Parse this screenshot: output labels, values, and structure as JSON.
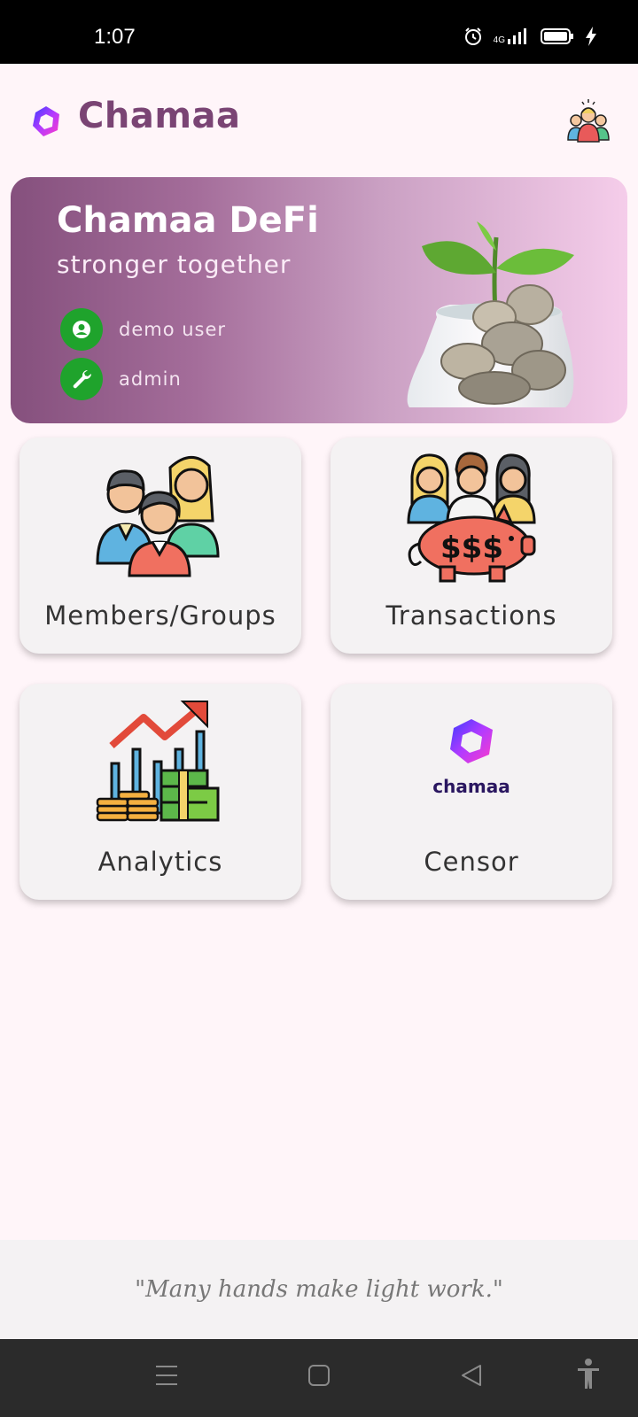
{
  "status_bar": {
    "time": "1:07",
    "network": "4G",
    "icons": [
      "alarm-icon",
      "signal-icon",
      "battery-icon",
      "charging-icon"
    ]
  },
  "app_bar": {
    "title": "Chamaa",
    "logo_icon": "chamaa-logo-icon",
    "avatar_icon": "group-avatar-icon"
  },
  "hero": {
    "title": "Chamaa DeFi",
    "subtitle": "stronger together",
    "user_label": "demo user",
    "role_label": "admin",
    "badge_color": "#1fa32c"
  },
  "cards": [
    {
      "label": "Members/Groups",
      "icon": "members-groups-icon"
    },
    {
      "label": "Transactions",
      "icon": "piggy-bank-icon"
    },
    {
      "label": "Analytics",
      "icon": "analytics-chart-icon"
    },
    {
      "label": "Censor",
      "icon": "chamaa-logo-icon",
      "logo_text": "chamaa"
    }
  ],
  "footer": {
    "quote": "\"Many hands make light work.\""
  },
  "nav": {
    "icons": [
      "menu-icon",
      "home-icon",
      "back-icon",
      "accessibility-icon"
    ]
  },
  "colors": {
    "brand": "#7a4474",
    "background": "#fff5f9",
    "card": "#f4f2f3"
  }
}
